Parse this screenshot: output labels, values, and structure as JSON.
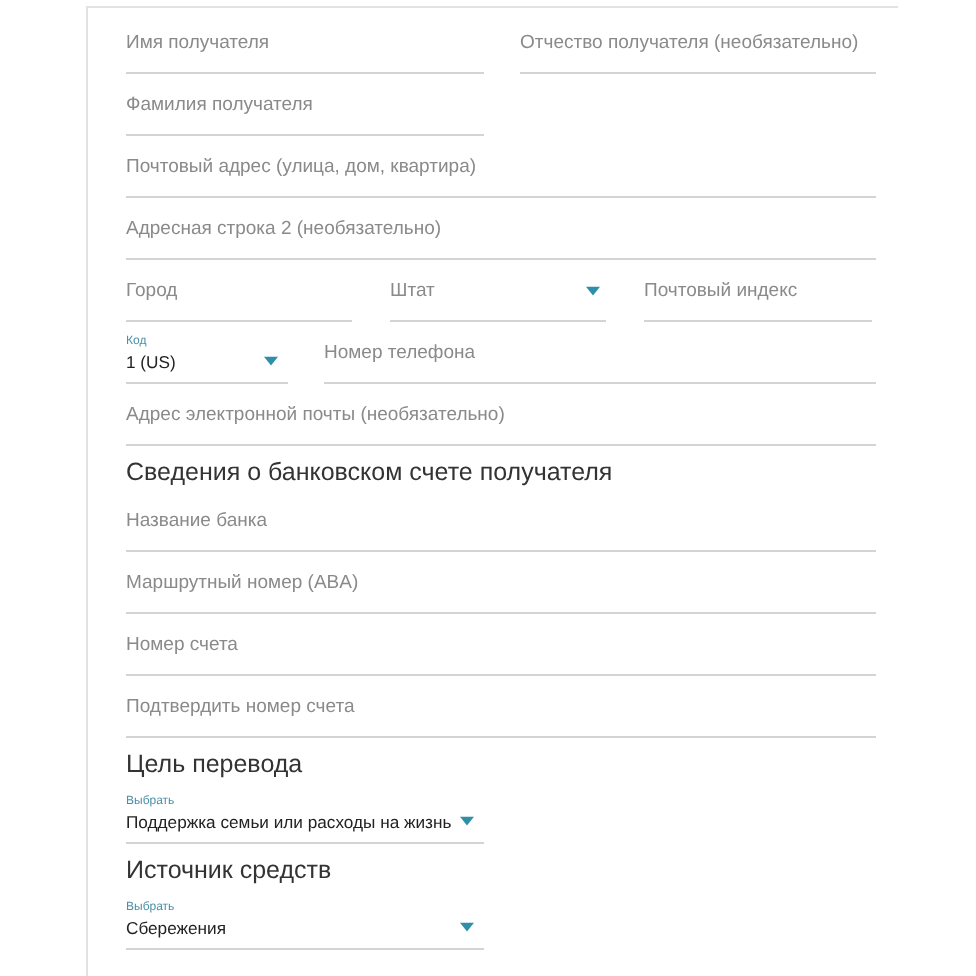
{
  "rows": [
    {
      "kind": "pair",
      "fields": [
        {
          "kind": "text",
          "placeholder": "Имя получателя"
        },
        {
          "kind": "text",
          "placeholder": "Отчество получателя (необязательно)"
        }
      ]
    },
    {
      "kind": "half",
      "fields": [
        {
          "kind": "text",
          "placeholder": "Фамилия получателя"
        }
      ]
    },
    {
      "kind": "full",
      "fields": [
        {
          "kind": "text",
          "placeholder": "Почтовый адрес (улица, дом, квартира)"
        }
      ]
    },
    {
      "kind": "full",
      "fields": [
        {
          "kind": "text",
          "placeholder": "Адресная строка 2 (необязательно)"
        }
      ]
    },
    {
      "kind": "address",
      "fields": [
        {
          "kind": "text",
          "placeholder": "Город"
        },
        {
          "kind": "select",
          "placeholder": "Штат"
        },
        {
          "kind": "text",
          "placeholder": "Почтовый индекс"
        }
      ]
    },
    {
      "kind": "phone",
      "fields": [
        {
          "kind": "select",
          "label": "Код",
          "value": "1 (US)"
        },
        {
          "kind": "text",
          "placeholder": "Номер телефона"
        }
      ]
    },
    {
      "kind": "full",
      "fields": [
        {
          "kind": "text",
          "placeholder": "Адрес электронной почты (необязательно)"
        }
      ]
    },
    {
      "kind": "heading",
      "text": "Сведения о банковском счете получателя"
    },
    {
      "kind": "full",
      "fields": [
        {
          "kind": "text",
          "placeholder": "Название банка"
        }
      ]
    },
    {
      "kind": "full",
      "fields": [
        {
          "kind": "text",
          "placeholder": "Маршрутный номер (ABA)"
        }
      ]
    },
    {
      "kind": "full",
      "fields": [
        {
          "kind": "text",
          "placeholder": "Номер счета"
        }
      ]
    },
    {
      "kind": "full",
      "fields": [
        {
          "kind": "text",
          "placeholder": "Подтвердить номер счета"
        }
      ]
    },
    {
      "kind": "heading",
      "text": "Цель перевода"
    },
    {
      "kind": "half",
      "fields": [
        {
          "kind": "select",
          "label": "Выбрать",
          "value": "Поддержка семьи или расходы на жизнь"
        }
      ]
    },
    {
      "kind": "heading",
      "text": "Источник средств"
    },
    {
      "kind": "half",
      "fields": [
        {
          "kind": "select",
          "label": "Выбрать",
          "value": "Сбережения"
        }
      ]
    }
  ]
}
